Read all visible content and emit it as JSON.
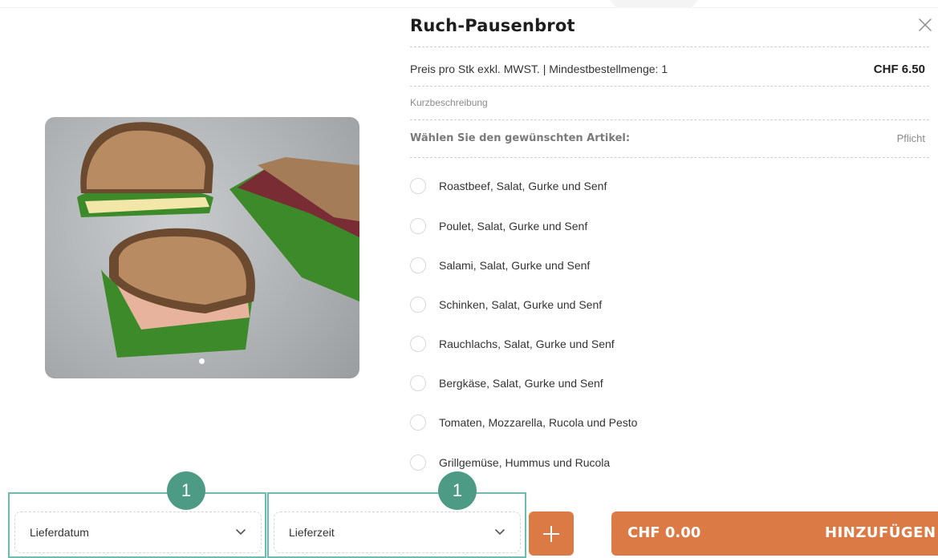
{
  "product": {
    "title": "Ruch-Pausenbrot",
    "price_info": "Preis pro Stk exkl. MWST. | Mindestbestellmenge: 1",
    "price": "CHF 6.50",
    "short_description_label": "Kurzbeschreibung",
    "choose_label": "Wählen Sie den gewünschten Artikel:",
    "required_label": "Pflicht",
    "options": [
      "Roastbeef, Salat, Gurke und Senf",
      "Poulet, Salat, Gurke und Senf",
      "Salami, Salat, Gurke und Senf",
      "Schinken, Salat, Gurke und Senf",
      "Rauchlachs, Salat, Gurke und Senf",
      "Bergkäse, Salat, Gurke und Senf",
      "Tomaten, Mozzarella, Rucola und Pesto",
      "Grillgemüse, Hummus und Rucola"
    ]
  },
  "footer": {
    "delivery_date_label": "Lieferdatum",
    "delivery_time_label": "Lieferzeit",
    "badge_1": "1",
    "badge_2": "1",
    "total": "CHF 0.00",
    "add_label": "HINZUFÜGEN"
  },
  "icons": {
    "close": "close-icon",
    "chevron": "chevron-down-icon",
    "plus": "plus-icon"
  },
  "colors": {
    "accent": "#db7a45",
    "highlight_border": "#6cbcb0",
    "badge": "#4e9b85"
  }
}
